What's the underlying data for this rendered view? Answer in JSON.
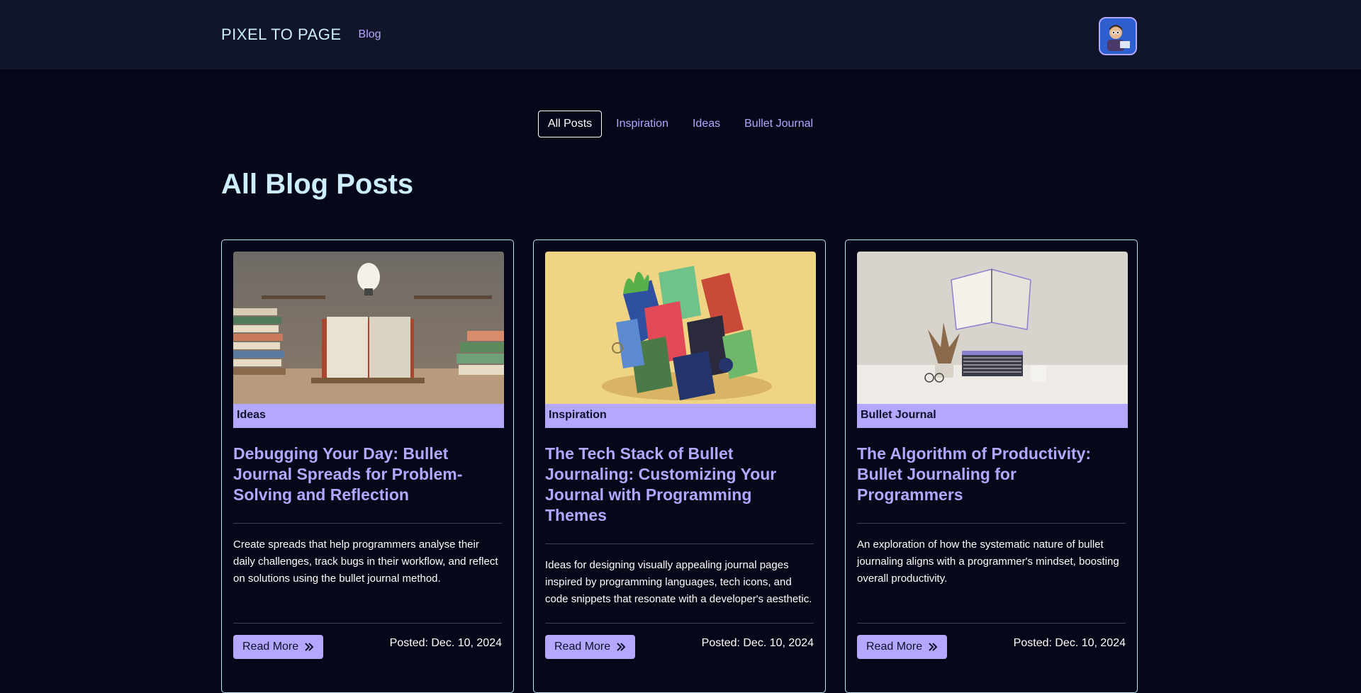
{
  "nav": {
    "brand": "PIXEL TO PAGE",
    "blog_link": "Blog"
  },
  "filters": [
    "All Posts",
    "Inspiration",
    "Ideas",
    "Bullet Journal"
  ],
  "page_title": "All Blog Posts",
  "posts": [
    {
      "category": "Ideas",
      "title": "Debugging Your Day: Bullet Journal Spreads for Problem-Solving and Reflection",
      "excerpt": "Create spreads that help programmers analyse their daily challenges, track bugs in their workflow, and reflect on solutions using the bullet journal method.",
      "read_more": "Read More",
      "posted": "Posted: Dec. 10, 2024"
    },
    {
      "category": "Inspiration",
      "title": "The Tech Stack of Bullet Journaling: Customizing Your Journal with Programming Themes",
      "excerpt": "Ideas for designing visually appealing journal pages inspired by programming languages, tech icons, and code snippets that resonate with a developer's aesthetic.",
      "read_more": "Read More",
      "posted": "Posted: Dec. 10, 2024"
    },
    {
      "category": "Bullet Journal",
      "title": "The Algorithm of Productivity: Bullet Journaling for Programmers",
      "excerpt": "An exploration of how the systematic nature of bullet journaling aligns with a programmer's mindset, boosting overall productivity.",
      "read_more": "Read More",
      "posted": "Posted: Dec. 10, 2024"
    }
  ],
  "colors": {
    "accent": "#b3a7ff",
    "title": "#cdeefd",
    "background": "#07071a",
    "navbar": "#11152a"
  },
  "icons": {
    "read_more": "double-chevron-right-icon"
  }
}
